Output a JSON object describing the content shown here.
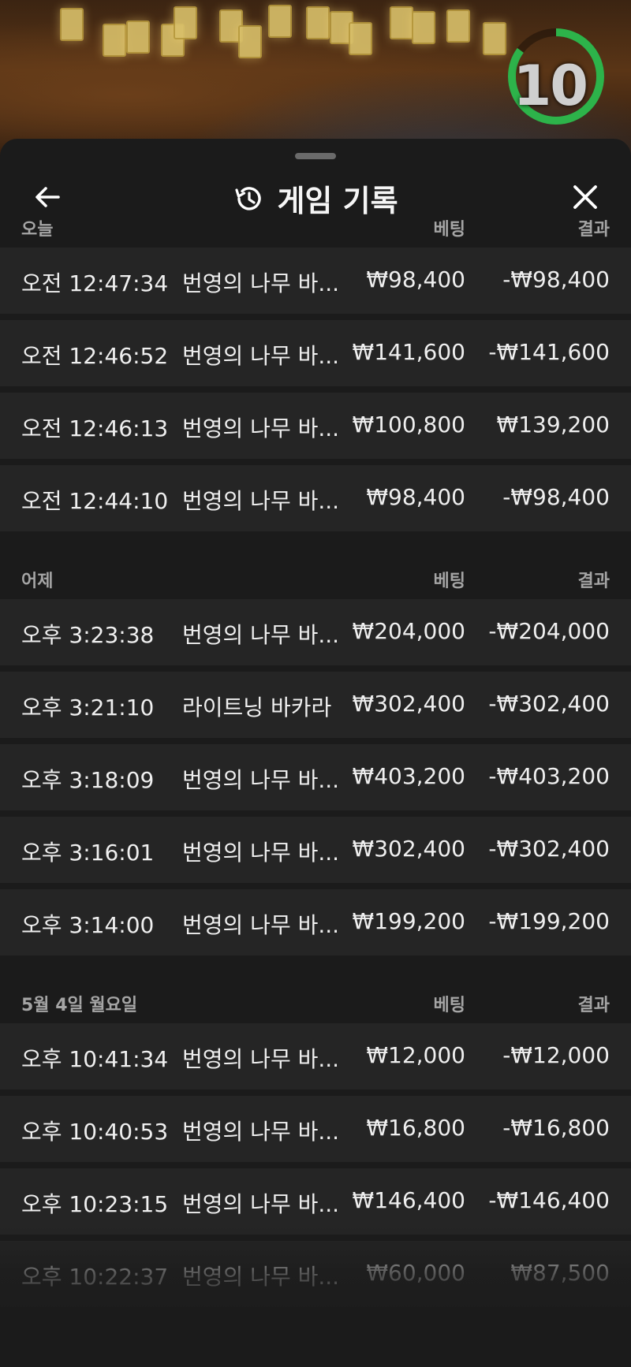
{
  "timer": {
    "value": "10",
    "progress": 0.85,
    "color": "#2db34a"
  },
  "header": {
    "title": "게임 기록",
    "back_icon": "arrow-left-icon",
    "history_icon": "history-icon",
    "close_icon": "close-icon"
  },
  "sections": [
    {
      "label": "오늘",
      "bet_header": "베팅",
      "result_header": "결과",
      "rows": [
        {
          "time": "오전 12:47:34",
          "game": "번영의 나무 바...",
          "bet": "₩98,400",
          "result": "-₩98,400"
        },
        {
          "time": "오전 12:46:52",
          "game": "번영의 나무 바...",
          "bet": "₩141,600",
          "result": "-₩141,600"
        },
        {
          "time": "오전 12:46:13",
          "game": "번영의 나무 바...",
          "bet": "₩100,800",
          "result": "₩139,200"
        },
        {
          "time": "오전 12:44:10",
          "game": "번영의 나무 바...",
          "bet": "₩98,400",
          "result": "-₩98,400"
        }
      ]
    },
    {
      "label": "어제",
      "bet_header": "베팅",
      "result_header": "결과",
      "rows": [
        {
          "time": "오후 3:23:38",
          "game": "번영의 나무 바...",
          "bet": "₩204,000",
          "result": "-₩204,000"
        },
        {
          "time": "오후 3:21:10",
          "game": "라이트닝 바카라",
          "bet": "₩302,400",
          "result": "-₩302,400"
        },
        {
          "time": "오후 3:18:09",
          "game": "번영의 나무 바...",
          "bet": "₩403,200",
          "result": "-₩403,200"
        },
        {
          "time": "오후 3:16:01",
          "game": "번영의 나무 바...",
          "bet": "₩302,400",
          "result": "-₩302,400"
        },
        {
          "time": "오후 3:14:00",
          "game": "번영의 나무 바...",
          "bet": "₩199,200",
          "result": "-₩199,200"
        }
      ]
    },
    {
      "label": "5월 4일 월요일",
      "bet_header": "베팅",
      "result_header": "결과",
      "rows": [
        {
          "time": "오후 10:41:34",
          "game": "번영의 나무 바...",
          "bet": "₩12,000",
          "result": "-₩12,000"
        },
        {
          "time": "오후 10:40:53",
          "game": "번영의 나무 바...",
          "bet": "₩16,800",
          "result": "-₩16,800"
        },
        {
          "time": "오후 10:23:15",
          "game": "번영의 나무 바...",
          "bet": "₩146,400",
          "result": "-₩146,400"
        },
        {
          "time": "오후 10:22:37",
          "game": "번영의 나무 바...",
          "bet": "₩60,000",
          "result": "₩87,500"
        }
      ]
    }
  ]
}
